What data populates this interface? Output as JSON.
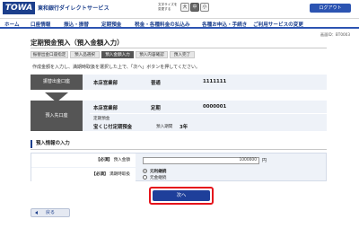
{
  "header": {
    "logo": "TOWA",
    "bank_name": "東和銀行",
    "service_name": "ダイレクトサービス",
    "fontsize_label": "文字サイズを変更する",
    "fontsize_options": [
      "大",
      "中",
      "小"
    ],
    "logout_label": "ログアウト"
  },
  "nav": {
    "items": [
      "ホーム",
      "口座情報",
      "振込・振替",
      "定期預金",
      "税金・各種料金の払込み",
      "各種お申込・手続き",
      "ご利用サービスの変更"
    ]
  },
  "screen_id": "画面ID：BT0003",
  "page": {
    "title": "定期預金預入（預入金額入力）",
    "steps": [
      "振替出金口座指定",
      "預入品選択",
      "預入金額入力",
      "預入内容確認",
      "預入完了"
    ],
    "instruction": "作成金額を入力し、満期時取扱を選択した上で、「次へ」ボタンを押してください。"
  },
  "source_account": {
    "label": "振替出金口座",
    "branch": "本店営業部",
    "type": "普通",
    "number": "1111111"
  },
  "deposit_account": {
    "label": "預入先口座",
    "branch": "本店営業部",
    "type": "定期",
    "number": "0000001",
    "product_category": "定期預金",
    "product_name": "宝くじ付定期預金",
    "term_label": "預入期間",
    "term_value": "3年"
  },
  "input_section": {
    "heading": "預入情報の入力",
    "required_tag": "【必須】",
    "amount_label": "預入金額",
    "amount_value": "1000000",
    "unit": "円",
    "maturity_label": "満期時取扱",
    "maturity_options": [
      {
        "label": "元利継続",
        "selected": true
      },
      {
        "label": "元金継続",
        "selected": false
      }
    ]
  },
  "actions": {
    "next_label": "次へ",
    "back_label": "戻る"
  },
  "colors": {
    "brand": "#1c3f8c",
    "button": "#1e3f9a",
    "highlight": "#e5131b",
    "panel": "#eef2f8"
  }
}
